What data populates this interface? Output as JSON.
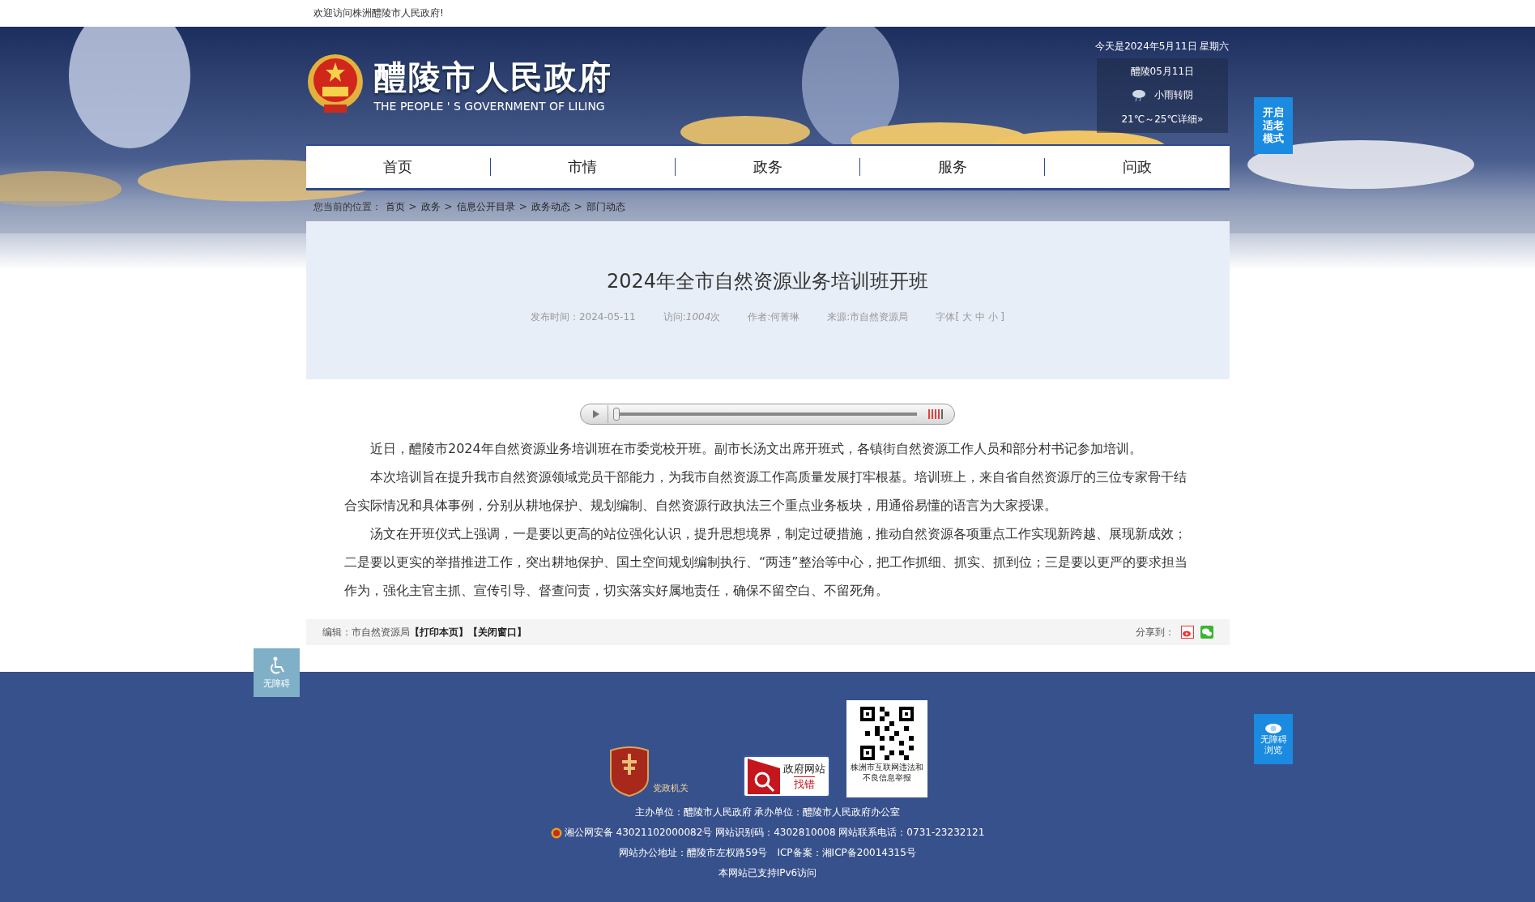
{
  "top_bar": {
    "welcome": "欢迎访问株洲醴陵市人民政府!"
  },
  "header": {
    "title": "醴陵市人民政府",
    "subtitle": "THE PEOPLE ' S GOVERNMENT OF LILING",
    "date": "今天是2024年5月11日 星期六",
    "weather": {
      "city_date": "醴陵05月11日",
      "condition": "小雨转阴",
      "temp": "21℃～25℃详细»"
    }
  },
  "elder_mode_button": "开启适老模式",
  "nav": [
    {
      "label": "首页"
    },
    {
      "label": "市情"
    },
    {
      "label": "政务"
    },
    {
      "label": "服务"
    },
    {
      "label": "问政"
    }
  ],
  "breadcrumb": {
    "prefix": "您当前的位置：",
    "items": [
      "首页",
      "政务",
      "信息公开目录",
      "政务动态",
      "部门动态"
    ],
    "separator": ">"
  },
  "article": {
    "title": "2024年全市自然资源业务培训班开班",
    "meta": [
      "发布时间：2024-05-11",
      {
        "label": "访问:",
        "count": "1004",
        "unit": "次"
      },
      "作者:何菁琳",
      "来源:市自然资源局",
      "字体[ 大 中 小 ]"
    ],
    "player": {
      "level": 0
    },
    "paragraphs": [
      "近日，醴陵市2024年自然资源业务培训班在市委党校开班。副市长汤文出席开班式，各镇街自然资源工作人员和部分村书记参加培训。",
      "本次培训旨在提升我市自然资源领域党员干部能力，为我市自然资源工作高质量发展打牢根基。培训班上，来自省自然资源厅的三位专家骨干结合实际情况和具体事例，分别从耕地保护、规划编制、自然资源行政执法三个重点业务板块，用通俗易懂的语言为大家授课。",
      "汤文在开班仪式上强调，一是要以更高的站位强化认识，提升思想境界，制定过硬措施，推动自然资源各项重点工作实现新跨越、展现新成效；二是要以更实的举措推进工作，突出耕地保护、国土空间规划编制执行、“两违”整治等中心，把工作抓细、抓实、抓到位；三是要以更严的要求担当作为，强化主官主抓、宣传引导、督查问责，切实落实好属地责任，确保不留空白、不留死角。"
    ]
  },
  "article_footer": {
    "editor": "编辑：市自然资源局",
    "links": [
      "【打印本页】",
      "【关闭窗口】"
    ],
    "share_label": "分享到："
  },
  "accessibility_button": "无障碍",
  "accessible_browse_button": "无障碍浏览",
  "footer": {
    "party_badge": "党政机关",
    "find_error": {
      "line1": "政府网站",
      "line2": "找错"
    },
    "qr_caption": "株洲市互联网违法和不良信息举报",
    "lines": [
      "主办单位：醴陵市人民政府 承办单位：醴陵市人民政府办公室",
      "湘公网安备 43021102000082号 网站识别码：4302810008 网站联系电话：0731-23232121",
      "网站办公地址：醴陵市左权路59号　ICP备案：湘ICP备20014315号",
      "本网站已支持IPv6访问"
    ]
  }
}
